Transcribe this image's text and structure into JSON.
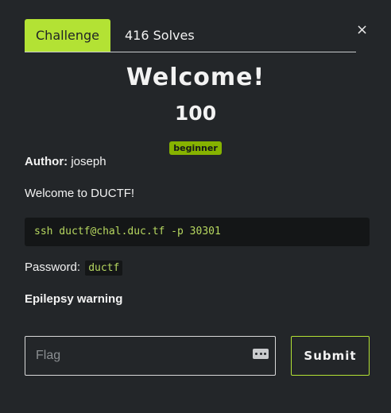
{
  "tabs": {
    "challenge": "Challenge",
    "solves": "416 Solves"
  },
  "close_icon": "×",
  "challenge": {
    "name": "Welcome!",
    "value": "100",
    "tag": "beginner",
    "author_label": "Author:",
    "author": "joseph",
    "description": "Welcome to DUCTF!",
    "command": "ssh ductf@chal.duc.tf -p 30301",
    "password_label": "Password:",
    "password": "ductf",
    "warning": "Epilepsy warning"
  },
  "form": {
    "flag_placeholder": "Flag",
    "submit_label": "Submit"
  },
  "colors": {
    "accent": "#b3e234",
    "background": "#232629",
    "code_bg": "#141617",
    "code_text": "#b7d860",
    "badge": "#86b300"
  }
}
